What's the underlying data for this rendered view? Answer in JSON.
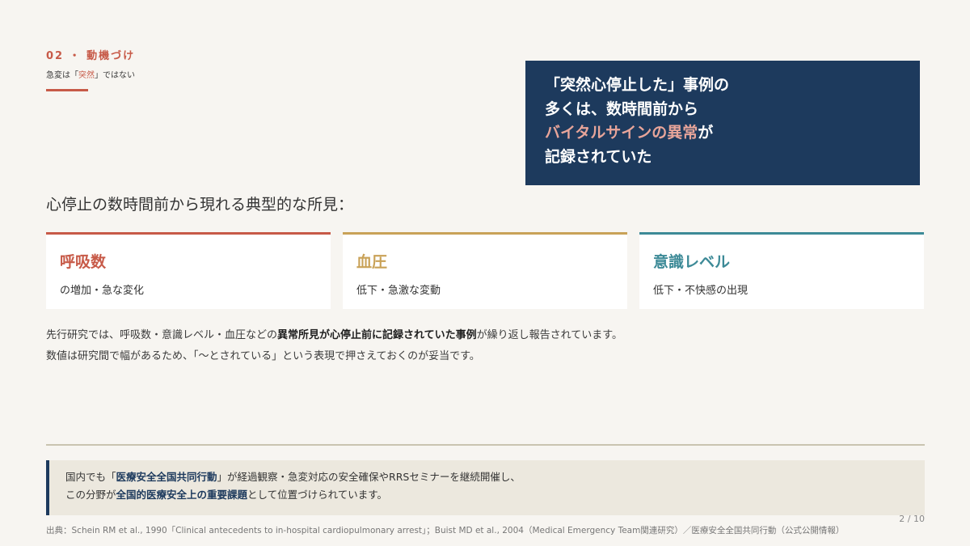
{
  "section": {
    "label": "02 ・ 動機づけ",
    "sub_prefix": "急変は「",
    "sub_accent": "突然",
    "sub_suffix": "」ではない"
  },
  "callout": {
    "line1": "「突然心停止した」事例の",
    "line2": "多くは、数時間前から",
    "line3_highlight": "バイタルサインの異常",
    "line3_suffix": "が",
    "line4": "記録されていた"
  },
  "lead": "心停止の数時間前から現れる典型的な所見：",
  "cards": [
    {
      "title": "呼吸数",
      "desc": "の増加・急な変化",
      "color": "#c75a48"
    },
    {
      "title": "血圧",
      "desc": "低下・急激な変動",
      "color": "#c9a258"
    },
    {
      "title": "意識レベル",
      "desc": "低下・不快感の出現",
      "color": "#3d8a97"
    }
  ],
  "body": {
    "p1_prefix": "先行研究では、呼吸数・意識レベル・血圧などの",
    "p1_bold": "異常所見が心停止前に記録されていた事例",
    "p1_suffix": "が繰り返し報告されています。",
    "p2": "数値は研究間で幅があるため、「〜とされている」という表現で押さえておくのが妥当です。"
  },
  "note": {
    "l1_prefix": "国内でも「",
    "l1_bold": "医療安全全国共同行動",
    "l1_suffix": "」が経過観察・急変対応の安全確保やRRSセミナーを継続開催し、",
    "l2_prefix": "この分野が",
    "l2_bold": "全国的医療安全上の重要課題",
    "l2_suffix": "として位置づけられています。"
  },
  "page_number": "2 / 10",
  "source": "出典：Schein RM et al., 1990「Clinical antecedents to in-hospital cardiopulmonary arrest」；Buist MD et al., 2004（Medical Emergency Team関連研究）／医療安全全国共同行動（公式公開情報）"
}
